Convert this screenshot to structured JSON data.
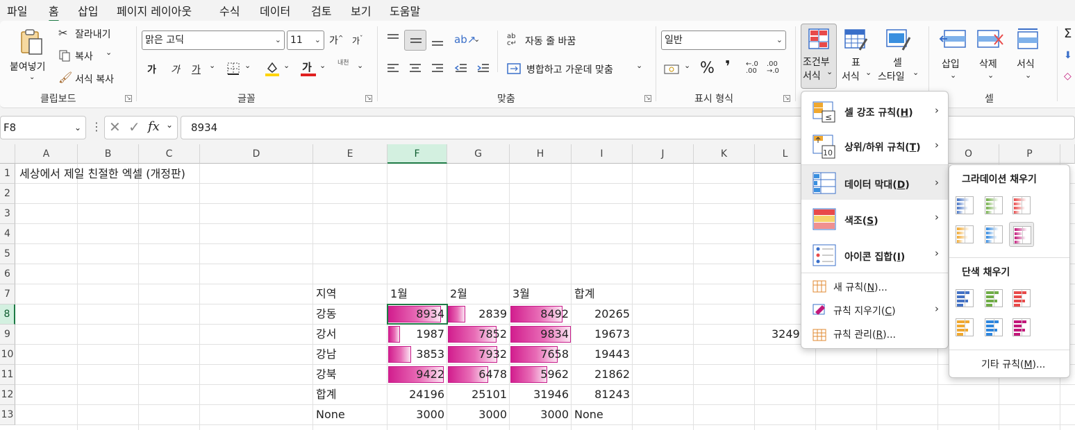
{
  "menubar": {
    "tabs": [
      "파일",
      "홈",
      "삽입",
      "페이지 레이아웃",
      "수식",
      "데이터",
      "검토",
      "보기",
      "도움말"
    ],
    "active": "홈"
  },
  "ribbon": {
    "clipboard": {
      "paste": "붙여넣기",
      "cut": "잘라내기",
      "copy": "복사",
      "format_painter": "서식 복사",
      "group": "클립보드"
    },
    "font": {
      "name": "맑은 고딕",
      "size": "11",
      "grow": "가",
      "shrink": "가",
      "bold": "가",
      "italic": "가",
      "underline": "가",
      "font_color": "가",
      "phonetic": "내천",
      "group": "글꼴"
    },
    "alignment": {
      "wrap": "자동 줄 바꿈",
      "merge": "병합하고 가운데 맞춤",
      "group": "맞춤"
    },
    "number": {
      "format": "일반",
      "percent": "%",
      "comma": "❜",
      "group": "표시 형식"
    },
    "styles": {
      "conditional_l1": "조건부",
      "conditional_l2": "서식",
      "table_l1": "표",
      "table_l2": "서식",
      "cell_l1": "셀",
      "cell_l2": "스타일"
    },
    "cells": {
      "insert": "삽입",
      "delete": "삭제",
      "format": "서식",
      "group": "셀"
    },
    "colors": {
      "accent": "#1e7a45",
      "bar": "#d21e8e",
      "highlight": "#ffd400",
      "fontred": "#e02020"
    }
  },
  "formula_bar": {
    "name_box": "F8",
    "fx": "fx",
    "value": "8934"
  },
  "grid": {
    "columns": [
      "A",
      "B",
      "C",
      "D",
      "E",
      "F",
      "G",
      "H",
      "I",
      "J",
      "K",
      "L",
      "M",
      "N",
      "O",
      "P"
    ],
    "rows": [
      "1",
      "2",
      "3",
      "4",
      "5",
      "6",
      "7",
      "8",
      "9",
      "10",
      "11",
      "12",
      "13"
    ],
    "title": "세상에서 제일 친절한 엑셀 (개정판)",
    "header": {
      "region": "지역",
      "m1": "1월",
      "m2": "2월",
      "m3": "3월",
      "total": "합계"
    },
    "data": [
      {
        "region": "강동",
        "m1": 8934,
        "m2": 2839,
        "m3": 8492,
        "total": 20265
      },
      {
        "region": "강서",
        "m1": 1987,
        "m2": 7852,
        "m3": 9834,
        "total": 19673
      },
      {
        "region": "강남",
        "m1": 3853,
        "m2": 7932,
        "m3": 7658,
        "total": 19443
      },
      {
        "region": "강북",
        "m1": 9422,
        "m2": 6478,
        "m3": 5962,
        "total": 21862
      }
    ],
    "sum_row": {
      "label": "합계",
      "m1": "24196",
      "m2": "25101",
      "m3": "31946",
      "total": "81243"
    },
    "none_row": {
      "label": "None",
      "m1": "3000",
      "m2": "3000",
      "m3": "3000",
      "total": "None"
    },
    "partial_cell": "3249"
  },
  "cf_menu": {
    "highlight": "셀 강조 규칙(",
    "highlight_key": "H",
    "topbottom": "상위/하위 규칙(",
    "topbottom_key": "T",
    "databar": "데이터 막대(",
    "databar_key": "D",
    "colorscale": "색조(",
    "colorscale_key": "S",
    "iconset": "아이콘 집합(",
    "iconset_key": "I",
    "new_rule": "새 규칙(",
    "new_rule_key": "N",
    "clear_rules": "규칙 지우기(",
    "clear_rules_key": "C",
    "manage_rules": "규칙 관리(",
    "manage_rules_key": "R",
    "close_paren": ")",
    "ellipsis_close": ")..."
  },
  "databar_submenu": {
    "gradient_title": "그라데이션 채우기",
    "solid_title": "단색 채우기",
    "more_rules": "기타 규칙(",
    "more_rules_key": "M",
    "more_rules_close": ")...",
    "swatch_colors": [
      "#4472c4",
      "#70ad47",
      "#e84a4a",
      "#f0a830",
      "#2e86de",
      "#c2187a"
    ]
  }
}
